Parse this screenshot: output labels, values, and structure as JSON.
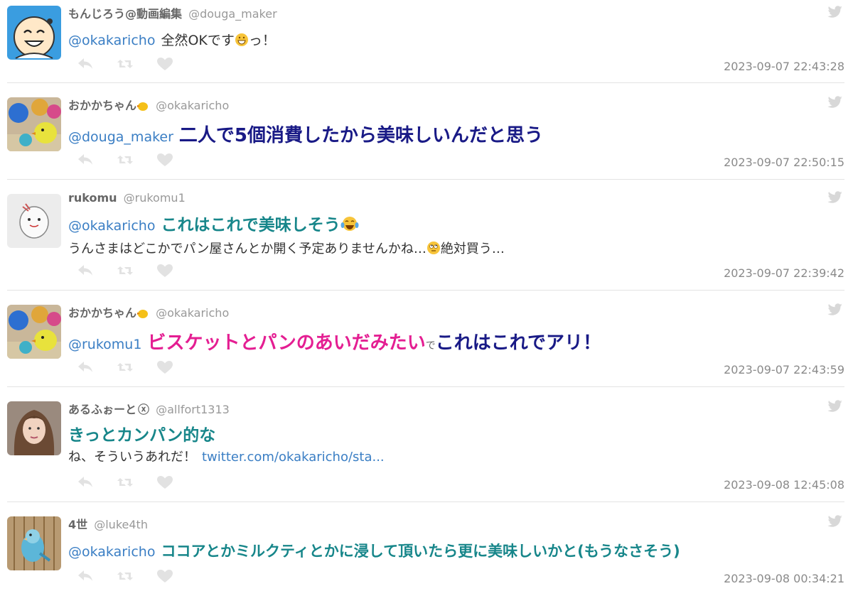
{
  "tweets": [
    {
      "name": "もんじろう@動画編集",
      "handle": "@douga_maker",
      "mention": "@okakaricho",
      "text1": "全然OKです",
      "text2": "っ！",
      "timestamp": "2023-09-07 22:43:28"
    },
    {
      "name": "おかかちゃん",
      "handle": "@okakaricho",
      "mention": "@douga_maker",
      "text1": "二人で5個消費したから美味しいんだと思う",
      "timestamp": "2023-09-07 22:50:15"
    },
    {
      "name": "rukomu",
      "handle": "@rukomu1",
      "mention": "@okakaricho",
      "text1": "これはこれで美味しそう",
      "line2a": "うんさまはどこかでパン屋さんとか開く予定ありませんかね…",
      "line2b": "絶対買う…",
      "timestamp": "2023-09-07 22:39:42"
    },
    {
      "name": "おかかちゃん",
      "handle": "@okakaricho",
      "mention": "@rukomu1",
      "text_pink": "ビスケットとパンのあいだみたい",
      "text_small": "で",
      "text_navy": "これはこれでアリ！",
      "timestamp": "2023-09-07 22:43:59"
    },
    {
      "name": "あるふぉーと",
      "name_suffix": "ⓧ",
      "handle": "@allfort1313",
      "text1": "きっとカンパン的な",
      "line2": "ね、そういうあれだ！",
      "link": "twitter.com/okakaricho/sta...",
      "timestamp": "2023-09-08 12:45:08"
    },
    {
      "name": "4世",
      "handle": "@luke4th",
      "mention": "@okakaricho",
      "text1": "ココアとかミルクティとかに浸して頂いたら更に美味しいかと(もうなさそう)",
      "timestamp": "2023-09-08 00:34:21"
    }
  ],
  "icons": [
    "reply-icon",
    "retweet-icon",
    "like-icon",
    "twitter-bird-icon"
  ],
  "colors": {
    "mention": "#3a7ec4",
    "teal": "#17868a",
    "navy": "#191a86",
    "pink": "#e41e92",
    "meta": "#8a8a8a"
  }
}
